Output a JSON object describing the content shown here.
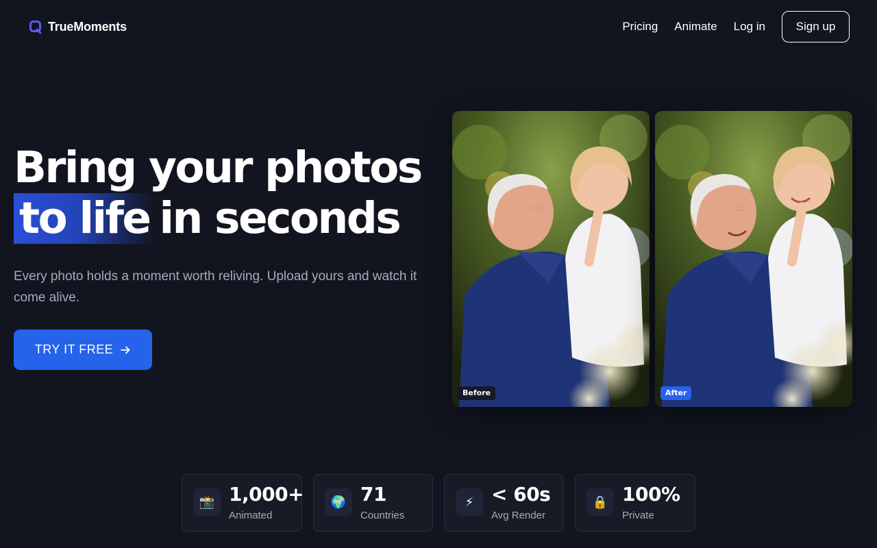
{
  "brand": {
    "name": "TrueMoments",
    "logo_icon": "q-logo-icon",
    "accent": "#4f46e5"
  },
  "nav": {
    "links": [
      "Pricing",
      "Animate",
      "Log in"
    ],
    "signup_label": "Sign up"
  },
  "hero": {
    "headline_line1": "Bring your photos",
    "headline_highlight": "to life",
    "headline_rest": "in seconds",
    "subtitle": "Every photo holds a moment worth reliving. Upload yours and watch it come alive.",
    "cta_label": "TRY IT FREE",
    "cta_icon": "arrow-right-icon",
    "cta_color": "#2563eb"
  },
  "photos": {
    "before_label": "Before",
    "after_label": "After"
  },
  "stats": [
    {
      "icon": "camera-flash-icon",
      "glyph": "📸",
      "value": "1,000+",
      "label": "Animated"
    },
    {
      "icon": "globe-icon",
      "glyph": "🌍",
      "value": "71",
      "label": "Countries"
    },
    {
      "icon": "lightning-icon",
      "glyph": "⚡",
      "value": "< 60s",
      "label": "Avg Render"
    },
    {
      "icon": "lock-icon",
      "glyph": "🔒",
      "value": "100%",
      "label": "Private"
    }
  ]
}
